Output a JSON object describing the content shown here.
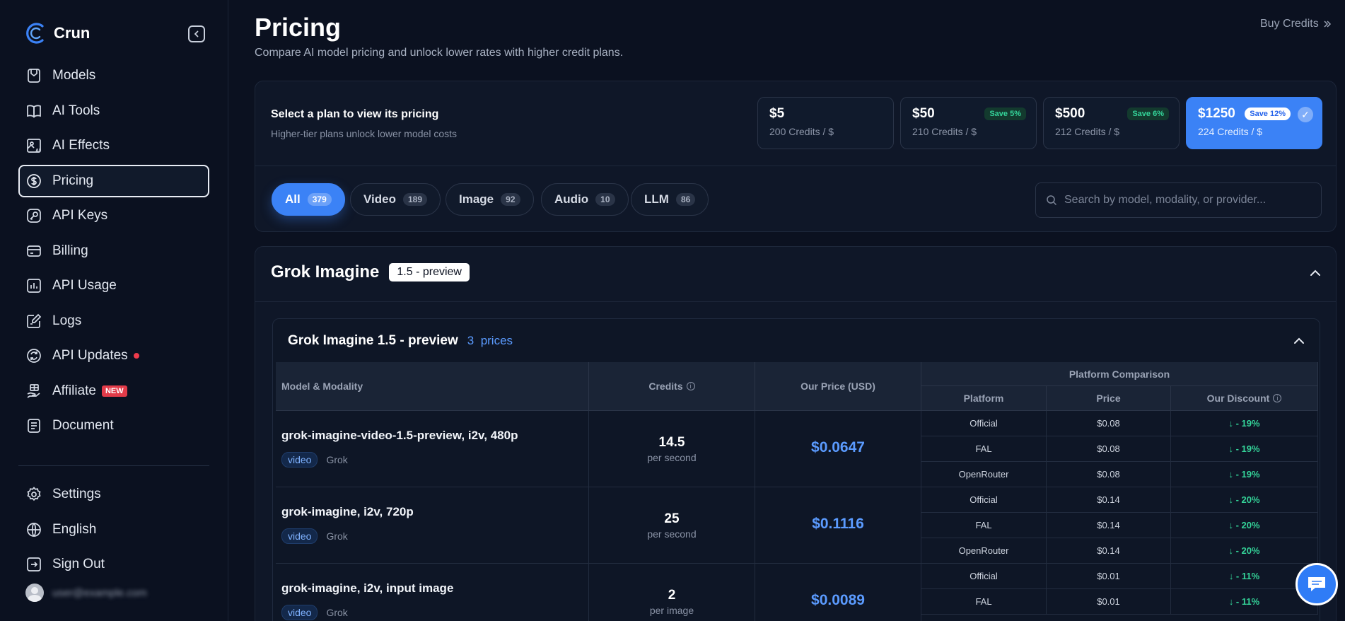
{
  "brand": {
    "name": "Crun"
  },
  "nav": {
    "items": [
      {
        "label": "Models",
        "icon": "models-icon"
      },
      {
        "label": "AI Tools",
        "icon": "book-icon"
      },
      {
        "label": "AI Effects",
        "icon": "ai-image-icon"
      },
      {
        "label": "Pricing",
        "icon": "dollar-icon",
        "active": true
      },
      {
        "label": "API Keys",
        "icon": "key-icon"
      },
      {
        "label": "Billing",
        "icon": "card-icon"
      },
      {
        "label": "API Usage",
        "icon": "bar-chart-icon"
      },
      {
        "label": "Logs",
        "icon": "edit-icon"
      },
      {
        "label": "API Updates",
        "icon": "refresh-icon"
      },
      {
        "label": "Affiliate",
        "icon": "gift-hand-icon",
        "badge": "NEW"
      },
      {
        "label": "Document",
        "icon": "document-icon"
      }
    ],
    "bottom": [
      {
        "label": "Settings",
        "icon": "gear-icon"
      },
      {
        "label": "English",
        "icon": "globe-icon"
      },
      {
        "label": "Sign Out",
        "icon": "sign-out-icon"
      }
    ],
    "user_email": "user@example.com"
  },
  "header": {
    "title": "Pricing",
    "subtitle": "Compare AI model pricing and unlock lower rates with higher credit plans.",
    "buy_credits": "Buy Credits"
  },
  "plans": {
    "title": "Select a plan to view its pricing",
    "subtitle": "Higher-tier plans unlock lower model costs",
    "tiers": [
      {
        "amount": "$5",
        "rate": "200 Credits / $",
        "save": ""
      },
      {
        "amount": "$50",
        "rate": "210 Credits / $",
        "save": "Save 5%"
      },
      {
        "amount": "$500",
        "rate": "212 Credits / $",
        "save": "Save 6%"
      },
      {
        "amount": "$1250",
        "rate": "224 Credits / $",
        "save": "Save 12%",
        "selected": true
      }
    ]
  },
  "filters": [
    {
      "label": "All",
      "count": "379",
      "active": true
    },
    {
      "label": "Video",
      "count": "189"
    },
    {
      "label": "Image",
      "count": "92"
    },
    {
      "label": "Audio",
      "count": "10"
    },
    {
      "label": "LLM",
      "count": "86"
    }
  ],
  "search": {
    "placeholder": "Search by model, modality, or provider..."
  },
  "group": {
    "title": "Grok Imagine",
    "version": "1.5 - preview",
    "model": {
      "title": "Grok Imagine 1.5 - preview",
      "prices_count": "3",
      "prices_label": "prices"
    }
  },
  "table": {
    "headers": {
      "model": "Model & Modality",
      "credits": "Credits",
      "our_price": "Our Price (USD)",
      "comparison": "Platform Comparison",
      "platform": "Platform",
      "price": "Price",
      "discount": "Our Discount"
    },
    "rows": [
      {
        "name": "grok-imagine-video-1.5-preview, i2v, 480p",
        "modality": "video",
        "provider": "Grok",
        "credits": "14.5",
        "unit": "per second",
        "price": "$0.0647",
        "platforms": [
          {
            "name": "Official",
            "price": "$0.08",
            "discount": "↓  - 19%"
          },
          {
            "name": "FAL",
            "price": "$0.08",
            "discount": "↓  - 19%"
          },
          {
            "name": "OpenRouter",
            "price": "$0.08",
            "discount": "↓  - 19%"
          }
        ]
      },
      {
        "name": "grok-imagine, i2v, 720p",
        "modality": "video",
        "provider": "Grok",
        "credits": "25",
        "unit": "per second",
        "price": "$0.1116",
        "platforms": [
          {
            "name": "Official",
            "price": "$0.14",
            "discount": "↓  - 20%"
          },
          {
            "name": "FAL",
            "price": "$0.14",
            "discount": "↓  - 20%"
          },
          {
            "name": "OpenRouter",
            "price": "$0.14",
            "discount": "↓  - 20%"
          }
        ]
      },
      {
        "name": "grok-imagine, i2v, input image",
        "modality": "video",
        "provider": "Grok",
        "credits": "2",
        "unit": "per image",
        "price": "$0.0089",
        "platforms": [
          {
            "name": "Official",
            "price": "$0.01",
            "discount": "↓  - 11%"
          },
          {
            "name": "FAL",
            "price": "$0.01",
            "discount": "↓  - 11%"
          }
        ]
      }
    ]
  },
  "colors": {
    "accent": "#3b82f6",
    "background": "#0b1120",
    "discount": "#34d399",
    "alert": "#ef3b4b"
  }
}
